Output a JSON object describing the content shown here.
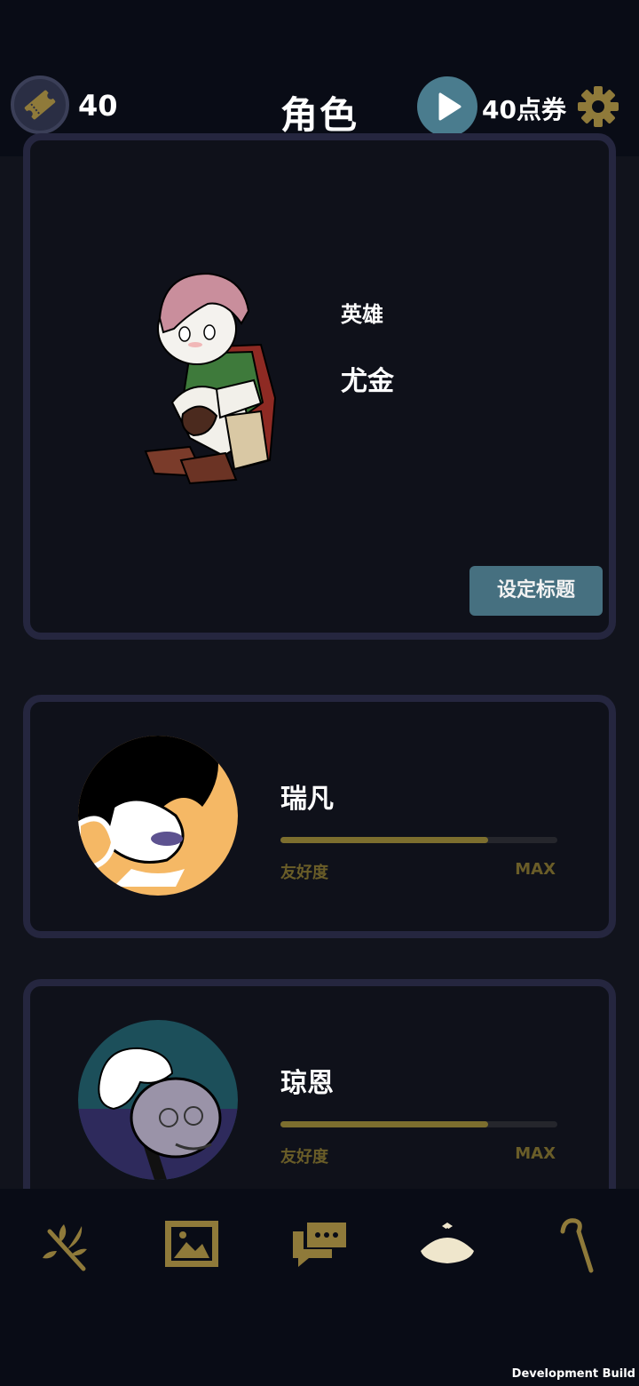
{
  "header": {
    "ticket_count": "40",
    "title": "角色",
    "voucher_text": "40点券"
  },
  "hero_card": {
    "role_label": "英雄",
    "name": "尤金",
    "set_title_button": "设定标题"
  },
  "characters": [
    {
      "name": "瑞凡",
      "friendship_label": "友好度",
      "friendship_status": "MAX",
      "friendship_fill": 0.75
    },
    {
      "name": "琼恩",
      "friendship_label": "友好度",
      "friendship_status": "MAX",
      "friendship_fill": 0.75
    }
  ],
  "bottom_nav": {
    "items": [
      {
        "icon": "branch-icon",
        "active": false
      },
      {
        "icon": "gallery-icon",
        "active": false
      },
      {
        "icon": "chat-icon",
        "active": false
      },
      {
        "icon": "characters-icon",
        "active": true
      },
      {
        "icon": "cane-icon",
        "active": false
      }
    ]
  },
  "footer": {
    "build_text": "Development Build"
  },
  "colors": {
    "accent_gold": "#8f7a3a",
    "button_teal": "#467080",
    "background": "#11131c"
  }
}
